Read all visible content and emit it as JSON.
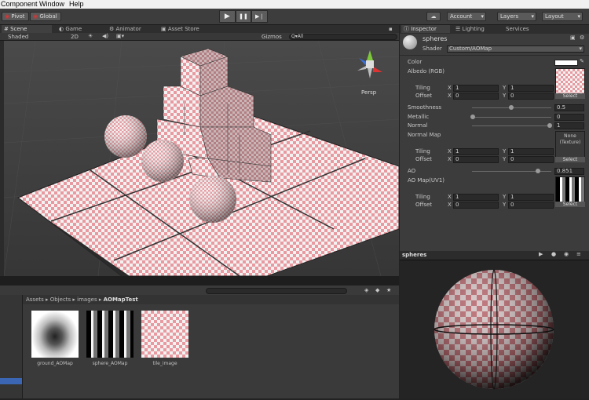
{
  "menu": [
    "Component",
    "Window",
    "Help"
  ],
  "toolbar": {
    "pivot": "Pivot",
    "global": "Global",
    "account": "Account",
    "layers": "Layers",
    "layout": "Layout",
    "play": "▶",
    "pause": "❚❚",
    "step": "▶❘"
  },
  "scene_tabs": {
    "scene": "Scene",
    "game": "Game",
    "animator": "Animator",
    "asset_store": "Asset Store"
  },
  "scene_bar": {
    "shaded": "Shaded",
    "mode2d": "2D",
    "gizmos": "Gizmos",
    "search_placeholder": "Q▾All",
    "persp": "Persp"
  },
  "project": {
    "breadcrumb": [
      "Assets",
      "Objects",
      "images",
      "AOMapTest"
    ],
    "items": [
      {
        "label": "ground_AOMap"
      },
      {
        "label": "sphere_AOMap"
      },
      {
        "label": "tile_image"
      }
    ]
  },
  "inspector": {
    "tabs": {
      "inspector": "Inspector",
      "lighting": "Lighting",
      "services": "Services"
    },
    "name": "spheres",
    "shader_label": "Shader",
    "shader_value": "Custom/AOMap",
    "color_label": "Color",
    "albedo_label": "Albedo (RGB)",
    "tiling_label": "Tiling",
    "offset_label": "Offset",
    "x": "X",
    "y": "Y",
    "albedo_tiling": [
      "1",
      "1"
    ],
    "albedo_offset": [
      "0",
      "0"
    ],
    "smoothness_label": "Smoothness",
    "smoothness_value": "0.5",
    "smoothness_level": 0.5,
    "metallic_label": "Metallic",
    "metallic_value": "0",
    "metallic_level": 0.0,
    "normal_label": "Normal",
    "normal_value": "1",
    "normal_level": 1.0,
    "normalmap_label": "Normal Map",
    "normalmap_none": "None",
    "normalmap_type": "(Texture)",
    "normal_tiling": [
      "1",
      "1"
    ],
    "normal_offset": [
      "0",
      "0"
    ],
    "ao_label": "AO",
    "ao_value": "0.851",
    "ao_level": 0.851,
    "aomap_label": "AO Map(UV1)",
    "ao_tiling": [
      "1",
      "1"
    ],
    "ao_offset": [
      "0",
      "0"
    ],
    "select": "Select"
  },
  "preview": {
    "title": "spheres"
  },
  "colors": {
    "checker_pink": "#e89aa0",
    "checker_white": "#f2f2f2",
    "selection_blue": "#3a66b4"
  }
}
